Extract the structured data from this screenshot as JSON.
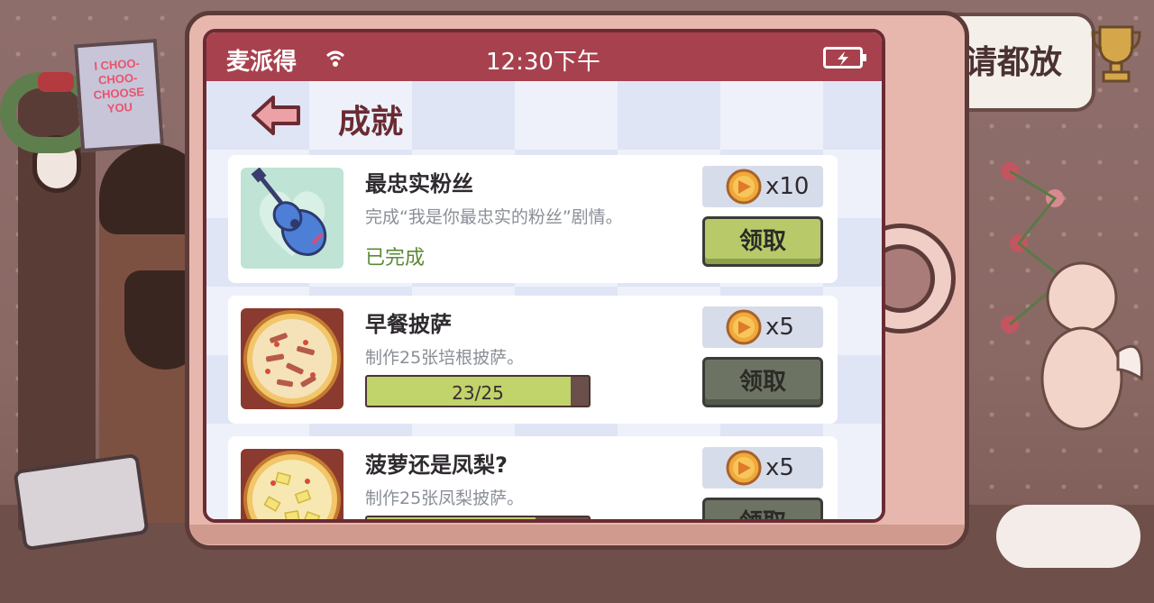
{
  "background": {
    "poster_text": "I CHOO-CHOO-CHOOSE YOU",
    "side_panel_text": "请都放"
  },
  "status_bar": {
    "carrier": "麦派得",
    "time": "12:30下午"
  },
  "header": {
    "title": "成就"
  },
  "achievements": [
    {
      "title": "最忠实粉丝",
      "description": "完成“我是你最忠实的粉丝”剧情。",
      "status": "已完成",
      "reward": "x10",
      "claim_label": "领取",
      "claimable": true,
      "icon": "guitar-icon"
    },
    {
      "title": "早餐披萨",
      "description": "制作25张培根披萨。",
      "progress_text": "23/25",
      "progress": 0.92,
      "reward": "x5",
      "claim_label": "领取",
      "claimable": false,
      "icon": "bacon-pizza-icon"
    },
    {
      "title": "菠萝还是凤梨?",
      "description": "制作25张凤梨披萨。",
      "progress": 0.76,
      "reward": "x5",
      "claim_label": "领取",
      "claimable": false,
      "icon": "pineapple-pizza-icon"
    }
  ],
  "colors": {
    "status_bar": "#a8414e",
    "claim_active": "#b8c96a",
    "claim_disabled": "#6c7363",
    "progress_fill": "#c1d36b",
    "completed_text": "#5b8a35"
  }
}
